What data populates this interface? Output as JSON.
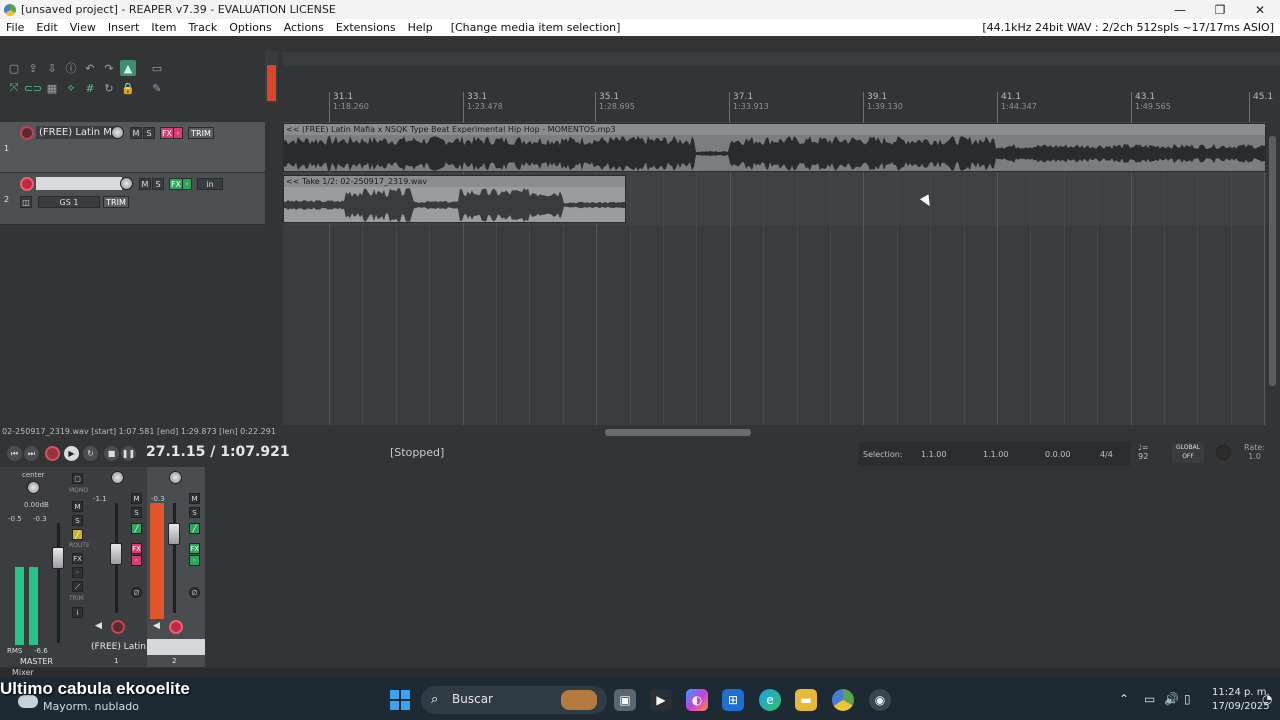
{
  "window": {
    "title": "[unsaved project] - REAPER v7.39 - EVALUATION LICENSE",
    "minimize": "—",
    "maximize": "❐",
    "close": "✕"
  },
  "menu": {
    "items": [
      "File",
      "Edit",
      "View",
      "Insert",
      "Item",
      "Track",
      "Options",
      "Actions",
      "Extensions",
      "Help"
    ],
    "action_hint": "[Change media item selection]",
    "audio_info": "[44.1kHz 24bit WAV : 2/2ch 512spls ~17/17ms ASIO]"
  },
  "ruler": {
    "marks": [
      {
        "bar": "31.1",
        "time": "1:18.260"
      },
      {
        "bar": "33.1",
        "time": "1:23.478"
      },
      {
        "bar": "35.1",
        "time": "1:28.695"
      },
      {
        "bar": "37.1",
        "time": "1:33.913"
      },
      {
        "bar": "39.1",
        "time": "1:39.130"
      },
      {
        "bar": "41.1",
        "time": "1:44.347"
      },
      {
        "bar": "43.1",
        "time": "1:49.565"
      },
      {
        "bar": "45.1",
        "time": ""
      }
    ]
  },
  "tracks": [
    {
      "number": "1",
      "name": "(FREE) Latin Mafia",
      "mute": "M",
      "solo": "S",
      "fx": "FX",
      "trim": "TRIM"
    },
    {
      "number": "2",
      "name": "",
      "mute": "M",
      "solo": "S",
      "fx": "FX",
      "input": "in",
      "input_label": "GS 1",
      "trim": "TRIM"
    }
  ],
  "items": {
    "item1_label": "<< (FREE) Latin Mafia x NSQK Type Beat  Experimental Hip Hop - MOMENTOS.mp3",
    "item2_label": "<< Take 1/2: 02-250917_2319.wav"
  },
  "info_line": "02-250917_2319.wav [start] 1:07.581 [end] 1:29.873 [len] 0:22.291",
  "transport": {
    "time": "27.1.15 / 1:07.921",
    "state": "[Stopped]",
    "selection_label": "Selection:",
    "sel_start": "1.1.00",
    "sel_end": "1.1.00",
    "sel_len": "0.0.00",
    "time_signature": "4/4",
    "bpm": "92",
    "global": "GLOBAL",
    "global_state": "OFF",
    "rate_label": "Rate:",
    "rate_value": "1.0"
  },
  "mixer": {
    "master": {
      "pan": "center",
      "vol": "0.00dB",
      "peak_l": "-0.5",
      "peak_r": "-0.3",
      "rms_label": "RMS",
      "rms_value": "-6.6",
      "name": "MASTER",
      "mono": "MONO",
      "mute": "M",
      "solo": "S",
      "route": "ROUTE",
      "fx": "FX",
      "trim": "TRIM",
      "info": "i"
    },
    "strips": [
      {
        "name": "(FREE) Latin M",
        "number": "1",
        "peak": "-1.1",
        "mute": "M",
        "solo": "S",
        "fx": "FX"
      },
      {
        "name": "",
        "number": "2",
        "peak": "-0.3",
        "mute": "M",
        "solo": "S",
        "fx": "FX"
      }
    ],
    "label": "Mixer"
  },
  "taskbar": {
    "news": "Ultimo cabula ekooelite",
    "weather": "Mayorm. nublado",
    "search": "Buscar",
    "time": "11:24 p. m.",
    "date": "17/09/2025"
  }
}
